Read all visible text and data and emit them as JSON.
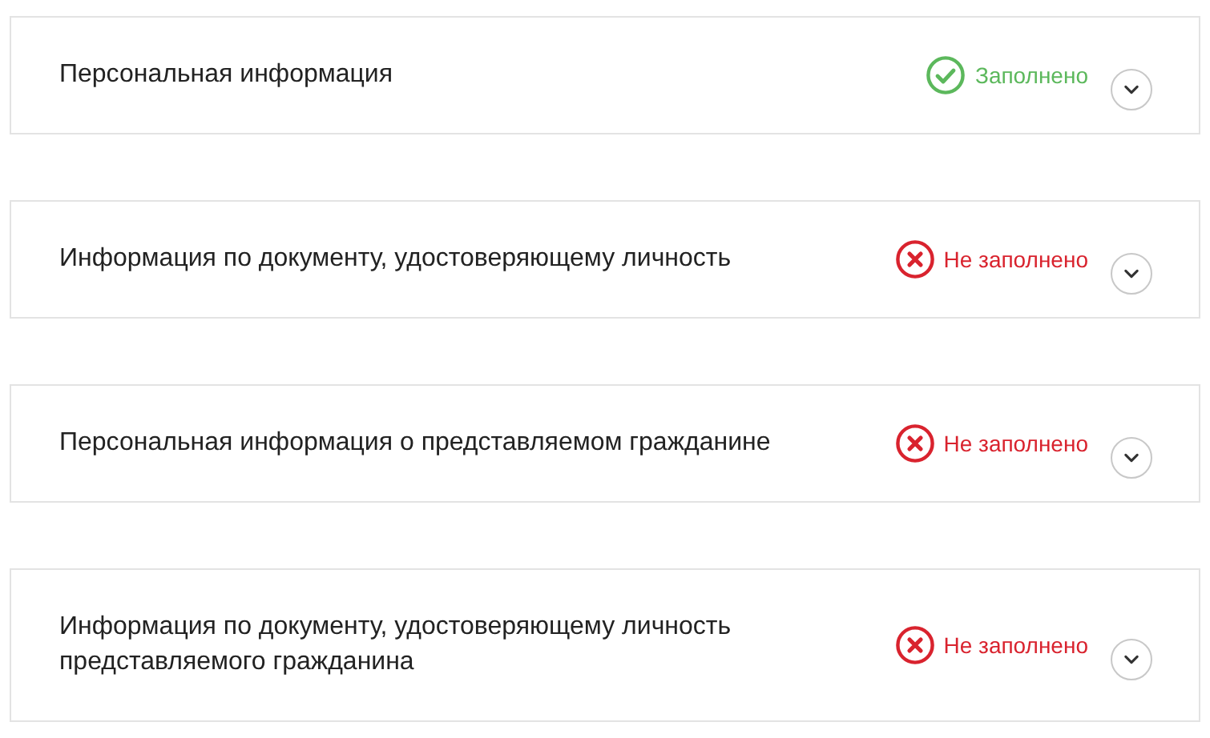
{
  "sections": [
    {
      "title": "Персональная информация",
      "status": "Заполнено",
      "filled": true
    },
    {
      "title": "Информация по документу, удостоверяющему личность",
      "status": "Не заполнено",
      "filled": false
    },
    {
      "title": "Персональная информация о представляемом гражданине",
      "status": "Не заполнено",
      "filled": false
    },
    {
      "title": "Информация по документу, удостоверяющему личность представляемого гражданина",
      "status": "Не заполнено",
      "filled": false
    }
  ]
}
